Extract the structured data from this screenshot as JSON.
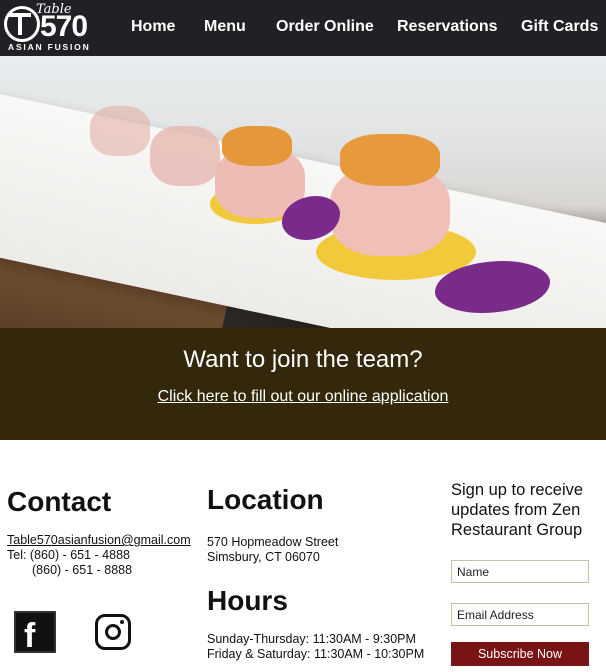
{
  "logo": {
    "script": "Table",
    "number": "570",
    "subtitle": "ASIAN FUSION"
  },
  "nav": {
    "items": [
      "Home",
      "Menu",
      "Order Online",
      "Reservations",
      "Gift Cards"
    ]
  },
  "banner": {
    "title": "Want to join the team?",
    "link": "Click here to fill out our online application"
  },
  "contact": {
    "heading": "Contact",
    "email": "Table570asianfusion@gmail.com",
    "tel1": "Tel: (860) - 651 - 4888",
    "tel2": "(860) - 651 - 8888"
  },
  "location": {
    "heading": "Location",
    "address1": "570 Hopmeadow Street",
    "address2": "Simsbury, CT 06070"
  },
  "hours": {
    "heading": "Hours",
    "line1": "Sunday-Thursday: 11:30AM - 9:30PM",
    "line2": "Friday & Saturday: 11:30AM - 10:30PM"
  },
  "newsletter": {
    "text": "Sign up to receive updates from Zen Restaurant Group",
    "name_placeholder": "Name",
    "email_placeholder": "Email Address",
    "button": "Subscribe Now"
  },
  "colors": {
    "nav_bg": "#1f2124",
    "banner_bg": "#33280b",
    "button_bg": "#7a1414"
  },
  "icons": [
    "facebook-icon",
    "instagram-icon"
  ]
}
